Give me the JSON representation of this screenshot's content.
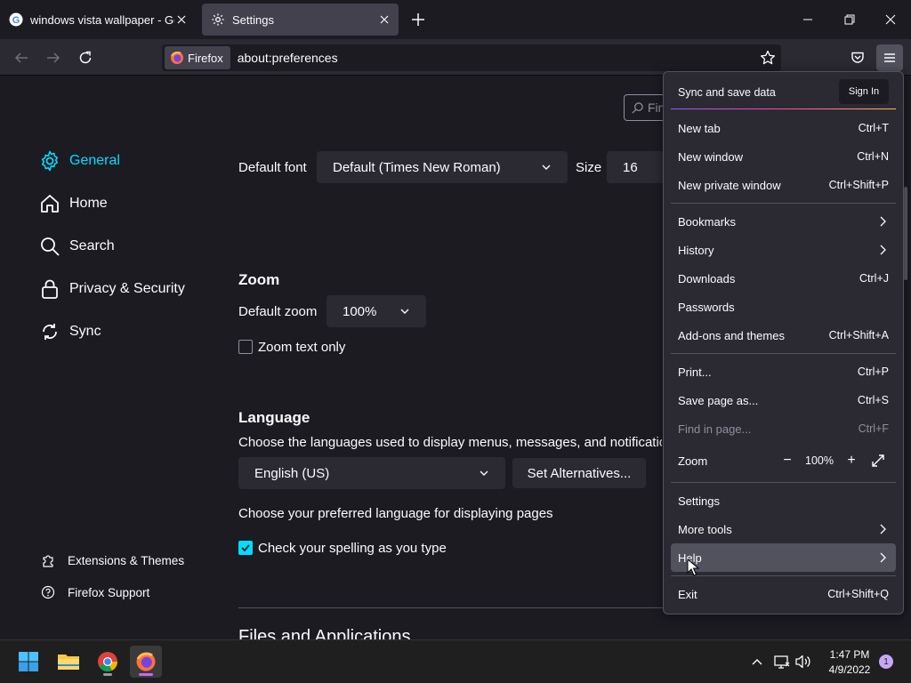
{
  "tabs": [
    {
      "title": "windows vista wallpaper - Google",
      "active": false,
      "favicon": "google-icon"
    },
    {
      "title": "Settings",
      "active": true,
      "favicon": "gear-icon"
    }
  ],
  "navbar": {
    "identity_label": "Firefox",
    "url": "about:preferences"
  },
  "find": {
    "placeholder": "Fin"
  },
  "sidebar": {
    "items": [
      {
        "label": "General",
        "icon": "gear-icon",
        "selected": true
      },
      {
        "label": "Home",
        "icon": "home-icon"
      },
      {
        "label": "Search",
        "icon": "search-icon"
      },
      {
        "label": "Privacy & Security",
        "icon": "lock-icon"
      },
      {
        "label": "Sync",
        "icon": "sync-icon"
      }
    ],
    "footer": [
      {
        "label": "Extensions & Themes",
        "icon": "puzzle-icon"
      },
      {
        "label": "Firefox Support",
        "icon": "help-icon"
      }
    ]
  },
  "fonts": {
    "default_font_label": "Default font",
    "default_font_value": "Default (Times New Roman)",
    "size_label": "Size",
    "size_value": "16"
  },
  "zoom": {
    "heading": "Zoom",
    "default_zoom_label": "Default zoom",
    "default_zoom_value": "100%",
    "zoom_text_only_label": "Zoom text only",
    "zoom_text_only_checked": false
  },
  "language": {
    "heading": "Language",
    "description": "Choose the languages used to display menus, messages, and notifications",
    "language_value": "English (US)",
    "set_alternatives_label": "Set Alternatives...",
    "pages_description": "Choose your preferred language for displaying pages",
    "spellcheck_label": "Check your spelling as you type",
    "spellcheck_checked": true
  },
  "files_heading": "Files and Applications",
  "appmenu": {
    "sync_label": "Sync and save data",
    "sign_in_label": "Sign In",
    "items_group1": [
      {
        "label": "New tab",
        "shortcut": "Ctrl+T"
      },
      {
        "label": "New window",
        "shortcut": "Ctrl+N"
      },
      {
        "label": "New private window",
        "shortcut": "Ctrl+Shift+P"
      }
    ],
    "items_group2": [
      {
        "label": "Bookmarks",
        "shortcut": ""
      },
      {
        "label": "History",
        "shortcut": ""
      },
      {
        "label": "Downloads",
        "shortcut": "Ctrl+J"
      },
      {
        "label": "Passwords",
        "shortcut": ""
      },
      {
        "label": "Add-ons and themes",
        "shortcut": "Ctrl+Shift+A"
      }
    ],
    "items_group3": [
      {
        "label": "Print...",
        "shortcut": "Ctrl+P"
      },
      {
        "label": "Save page as...",
        "shortcut": "Ctrl+S"
      },
      {
        "label": "Find in page...",
        "shortcut": "Ctrl+F",
        "disabled": true
      }
    ],
    "zoom_label": "Zoom",
    "zoom_minus": "−",
    "zoom_value": "100%",
    "zoom_plus": "+",
    "items_group4": [
      {
        "label": "Settings",
        "shortcut": ""
      },
      {
        "label": "More tools",
        "shortcut": ""
      },
      {
        "label": "Help",
        "shortcut": "",
        "hovered": true
      }
    ],
    "exit_label": "Exit",
    "exit_shortcut": "Ctrl+Shift+Q"
  },
  "taskbar": {
    "apps": [
      "start-icon",
      "file-explorer-icon",
      "chrome-icon",
      "firefox-icon"
    ],
    "time": "1:47 PM",
    "date": "4/9/2022",
    "notification_count": "1"
  },
  "colors": {
    "accent": "#00ddff",
    "background": "#1c1b22",
    "panel": "#2b2a33"
  }
}
